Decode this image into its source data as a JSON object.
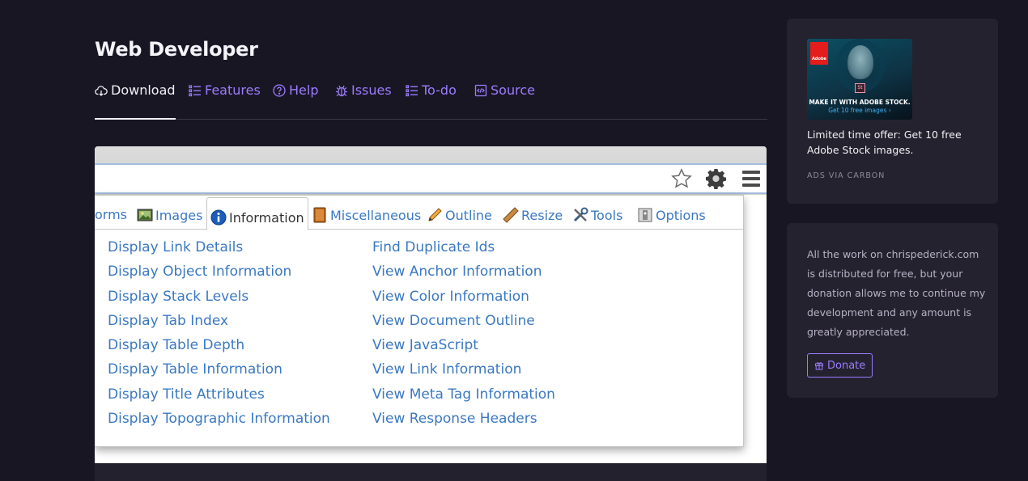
{
  "header": {
    "title": "Web Developer"
  },
  "nav": {
    "items": [
      {
        "label": "Download",
        "icon": "cloud-download-icon",
        "active": true
      },
      {
        "label": "Features",
        "icon": "list-icon"
      },
      {
        "label": "Help",
        "icon": "question-circle-icon"
      },
      {
        "label": "Issues",
        "icon": "bug-icon"
      },
      {
        "label": "To-do",
        "icon": "checklist-icon"
      },
      {
        "label": "Source",
        "icon": "code-file-icon"
      }
    ]
  },
  "screenshot": {
    "tabs": [
      {
        "label": "orms",
        "icon": "forms-icon"
      },
      {
        "label": "Images",
        "icon": "image-icon"
      },
      {
        "label": "Information",
        "icon": "info-icon",
        "active": true
      },
      {
        "label": "Miscellaneous",
        "icon": "book-icon"
      },
      {
        "label": "Outline",
        "icon": "pencil-icon"
      },
      {
        "label": "Resize",
        "icon": "ruler-icon"
      },
      {
        "label": "Tools",
        "icon": "tools-icon"
      },
      {
        "label": "Options",
        "icon": "options-icon"
      }
    ],
    "left_links": [
      "Display Link Details",
      "Display Object Information",
      "Display Stack Levels",
      "Display Tab Index",
      "Display Table Depth",
      "Display Table Information",
      "Display Title Attributes",
      "Display Topographic Information"
    ],
    "right_links": [
      "Find Duplicate Ids",
      "View Anchor Information",
      "View Color Information",
      "View Document Outline",
      "View JavaScript",
      "View Link Information",
      "View Meta Tag Information",
      "View Response Headers"
    ]
  },
  "ad": {
    "logo_text": "Adobe",
    "badge": "St",
    "image_headline": "MAKE IT WITH ADOBE STOCK.",
    "image_cta": "Get 10 free images ›",
    "text": "Limited time offer: Get 10 free Adobe Stock images.",
    "via": "ADS VIA CARBON"
  },
  "donate": {
    "text": "All the work on chrispederick.com is distributed for free, but your donation allows me to continue my development and any amount is greatly appreciated.",
    "button_label": "Donate"
  },
  "colors": {
    "background": "#191624",
    "card": "#25222f",
    "accent": "#9a7dff",
    "link_blue": "#3a78c2"
  }
}
